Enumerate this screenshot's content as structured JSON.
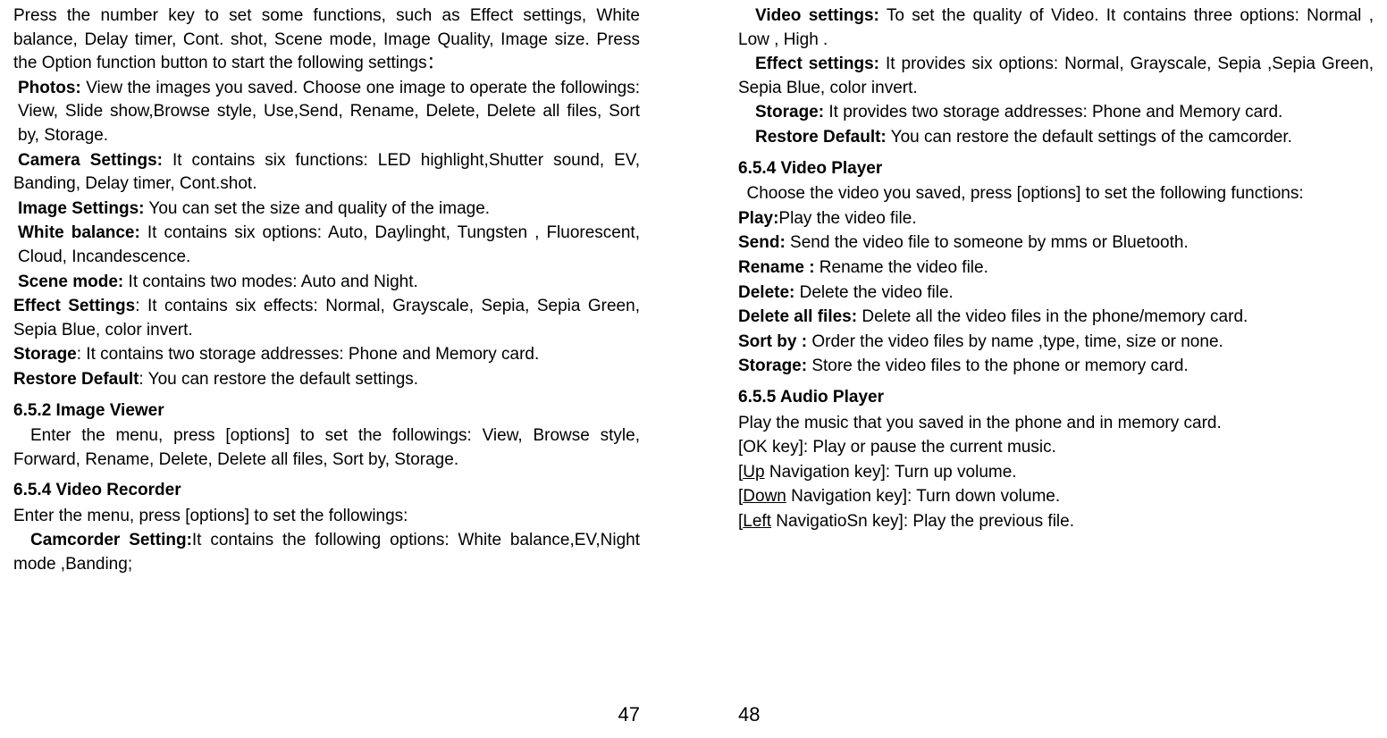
{
  "left": {
    "intro": "Press the number key to set some functions, such as Effect settings, White balance, Delay timer, Cont. shot, Scene mode, Image Quality, Image size. Press the Option function button to start the following settings：",
    "photos_label": "Photos:",
    "photos_text": " View the images you saved. Choose one image to operate the followings: View, Slide show,Browse style, Use,Send, Rename, Delete, Delete all files, Sort by, Storage.",
    "camera_label": "Camera Settings:",
    "camera_text": " It contains six functions: LED highlight,Shutter sound, EV, Banding, Delay timer, Cont.shot.",
    "image_label": "Image Settings:",
    "image_text": " You can set the size and quality of the image.",
    "wb_label": "White balance:",
    "wb_text": " It contains six options: Auto, Daylinght, Tungsten , Fluorescent, Cloud, Incandescence.",
    "scene_label": "Scene mode:",
    "scene_text": " It contains two modes: Auto and Night.",
    "effect_label": "Effect Settings",
    "effect_text": ": It contains six effects: Normal, Grayscale, Sepia, Sepia Green, Sepia Blue, color invert.",
    "storage_label": "Storage",
    "storage_text": ": It contains two storage addresses: Phone and Memory card.",
    "restore_label": "Restore Default",
    "restore_text": ": You can restore the default settings.",
    "h_image_viewer": "6.5.2 Image Viewer",
    "image_viewer_text": "Enter the menu, press [options] to set the followings: View, Browse style, Forward, Rename, Delete, Delete all files, Sort by, Storage.",
    "h_video_recorder": "6.5.4 Video Recorder",
    "video_recorder_intro": "Enter the menu, press [options] to set the followings:",
    "camcorder_label": "Camcorder Setting:",
    "camcorder_text": "It contains the following options: White balance,EV,Night mode ,Banding;",
    "page_num": "47"
  },
  "right": {
    "video_settings_label": "Video settings:",
    "video_settings_text": " To set the quality of Video. It contains three options: Normal , Low , High .",
    "effect_label": "Effect settings:",
    "effect_text": " It provides six options: Normal, Grayscale, Sepia ,Sepia Green, Sepia Blue, color invert.",
    "storage_label": "Storage:",
    "storage_text": " It provides two storage addresses: Phone and Memory card.",
    "restore_label": "Restore Default:",
    "restore_text": " You can restore the default settings of the camcorder.",
    "h_video_player": "6.5.4 Video Player",
    "video_player_intro": "Choose the video you saved, press [options] to set the following functions:",
    "play_label": "Play:",
    "play_text": "Play the video file.",
    "send_label": "Send:",
    "send_text": " Send the video file to someone by mms or Bluetooth.",
    "rename_label": "Rename :",
    "rename_text": " Rename the video file.",
    "delete_label": "Delete:",
    "delete_text": " Delete the video file.",
    "delete_all_label": "Delete all files:",
    "delete_all_text": " Delete all the video files in the phone/memory card.",
    "sort_label": "Sort by :",
    "sort_text": " Order the video files by name ,type, time, size or none.",
    "storage2_label": "Storage:",
    "storage2_text": " Store the video files to the phone or memory card.",
    "h_audio_player": "6.5.5 Audio Player",
    "audio_intro": "Play the music that you saved in the phone and in memory card.",
    "ok_key": "[OK key]: Play or pause the current music.",
    "up_prefix": "[",
    "up_key": "Up",
    "up_suffix": " Navigation key]: Turn up volume.",
    "down_prefix": "[",
    "down_key": "Down",
    "down_suffix": " Navigation key]: Turn down volume.",
    "left_prefix": "[",
    "left_key": "Left",
    "left_suffix": " NavigatioSn key]: Play the previous file.",
    "page_num": "48"
  }
}
